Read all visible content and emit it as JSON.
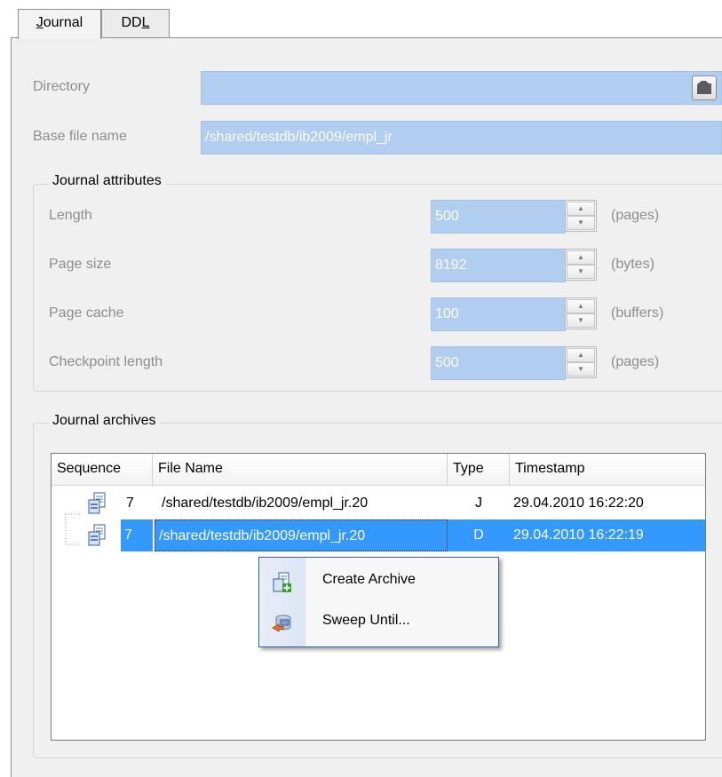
{
  "tabs": [
    {
      "label_pre": "",
      "label_u": "J",
      "label_post": "ournal"
    },
    {
      "label_pre": "DD",
      "label_u": "L",
      "label_post": ""
    }
  ],
  "directory": {
    "label": "Directory",
    "value": ""
  },
  "base_file": {
    "label": "Base file name",
    "value": "/shared/testdb/ib2009/empl_jr"
  },
  "journal_attributes": {
    "title": "Journal attributes",
    "rows": [
      {
        "label": "Length",
        "value": "500",
        "unit": "(pages)"
      },
      {
        "label": "Page size",
        "value": "8192",
        "unit": "(bytes)"
      },
      {
        "label": "Page cache",
        "value": "100",
        "unit": "(buffers)"
      },
      {
        "label": "Checkpoint length",
        "value": "500",
        "unit": "(pages)"
      }
    ]
  },
  "archives": {
    "title": "Journal archives",
    "columns": [
      "Sequence",
      "File Name",
      "Type",
      "Timestamp"
    ],
    "rows": [
      {
        "sequence": "7",
        "file": "/shared/testdb/ib2009/empl_jr.20",
        "type": "J",
        "timestamp": "29.04.2010 16:22:20",
        "selected": false
      },
      {
        "sequence": "7",
        "file": "/shared/testdb/ib2009/empl_jr.20",
        "type": "D",
        "timestamp": "29.04.2010 16:22:19",
        "selected": true
      }
    ]
  },
  "context_menu": {
    "items": [
      {
        "label": "Create Archive",
        "icon": "create-archive-icon"
      },
      {
        "label": "Sweep Until...",
        "icon": "sweep-icon"
      }
    ]
  },
  "colors": {
    "selection": "#3399ff",
    "field_fill": "#b1cdf0",
    "panel": "#f0f0f0"
  }
}
